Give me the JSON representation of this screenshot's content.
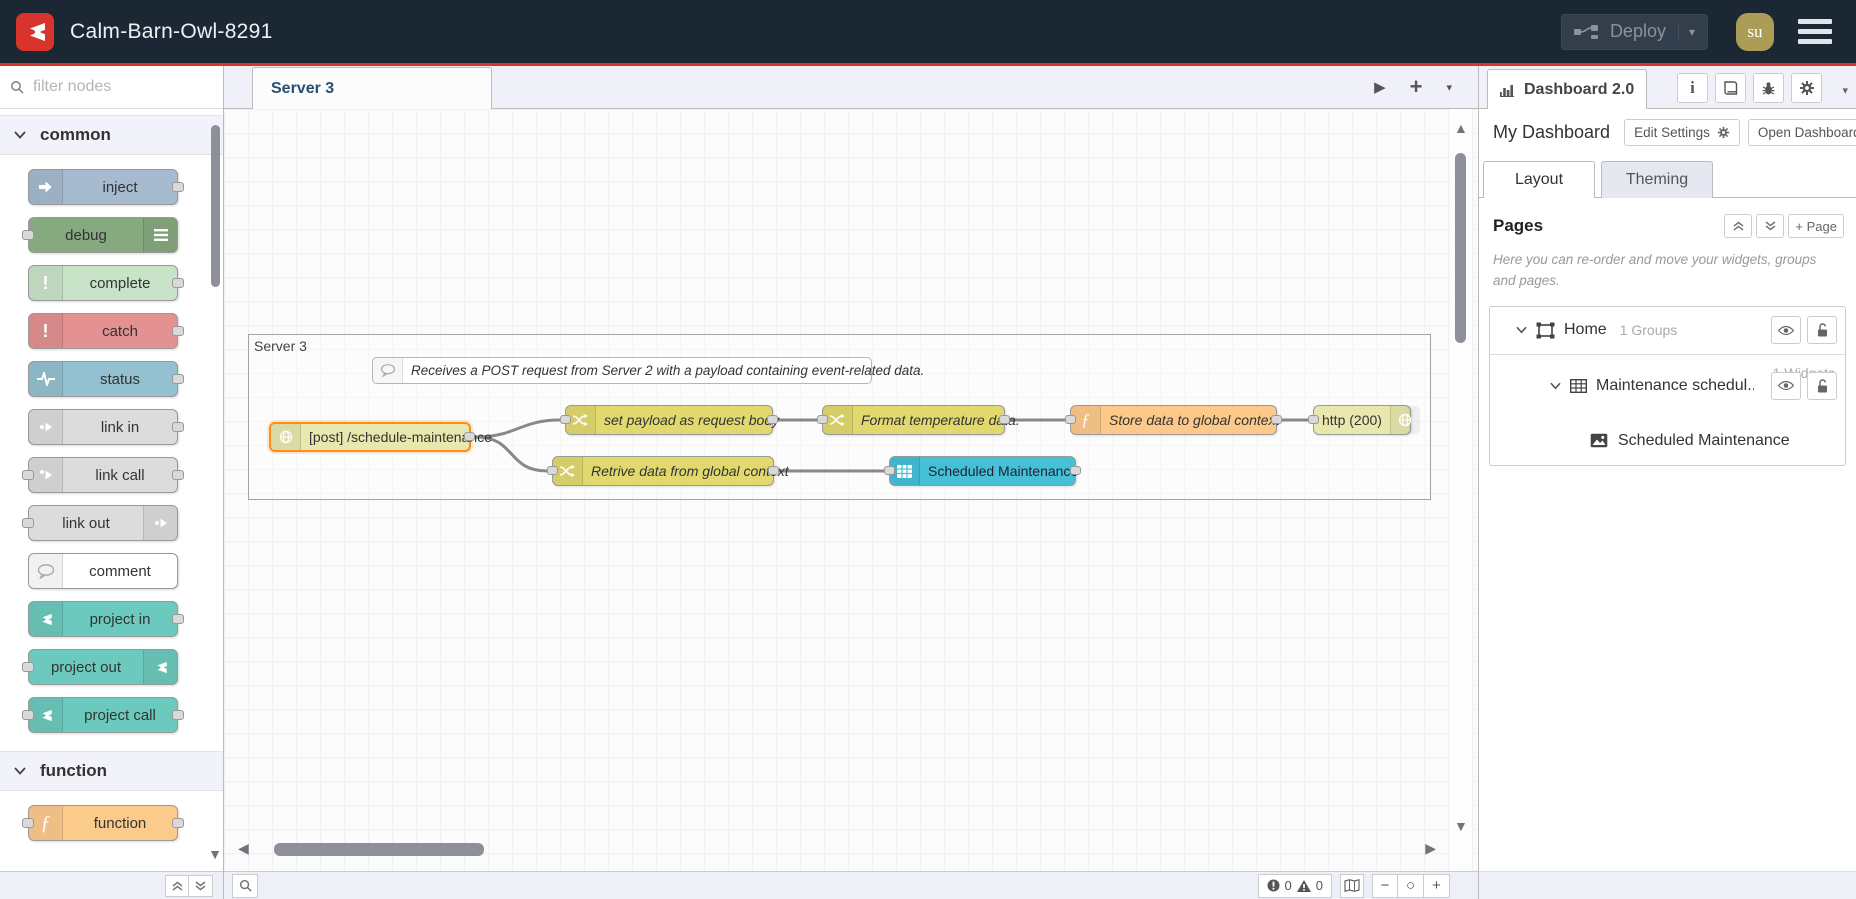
{
  "header": {
    "title": "Calm-Barn-Owl-8291",
    "deploy_label": "Deploy",
    "user_initials": "su"
  },
  "palette": {
    "search_placeholder": "filter nodes",
    "categories": [
      {
        "label": "common",
        "nodes": [
          {
            "label": "inject"
          },
          {
            "label": "debug"
          },
          {
            "label": "complete"
          },
          {
            "label": "catch"
          },
          {
            "label": "status"
          },
          {
            "label": "link in"
          },
          {
            "label": "link call"
          },
          {
            "label": "link out"
          },
          {
            "label": "comment"
          },
          {
            "label": "project in"
          },
          {
            "label": "project out"
          },
          {
            "label": "project call"
          }
        ]
      },
      {
        "label": "function",
        "nodes": [
          {
            "label": "function"
          }
        ]
      }
    ]
  },
  "workspace": {
    "tab_label": "Server 3",
    "group_label": "Server 3",
    "comment_text": "Receives a POST request from Server 2 with a payload containing event-related data.",
    "nodes": {
      "http_in": "[post] /schedule-maintenance",
      "set_payload": "set payload as request body",
      "format_temp": "Format temperature data.",
      "store_data": "Store data to global context",
      "http_response": "http (200)",
      "retrieve_data": "Retrive data from global context",
      "table_widget": "Scheduled Maintenance"
    }
  },
  "sidebar": {
    "tab_label": "Dashboard 2.0",
    "dashboard_name": "My Dashboard",
    "edit_settings_label": "Edit Settings",
    "open_dashboard_label": "Open Dashboard",
    "layout_tab": "Layout",
    "theming_tab": "Theming",
    "pages_title": "Pages",
    "add_page_label": "+ Page",
    "help_text": "Here you can re-order and move your widgets, groups and pages.",
    "tree": {
      "page_label": "Home",
      "page_meta": "1 Groups",
      "group_label": "Maintenance schedul...",
      "group_meta": "1 Widgets",
      "widget_label": "Scheduled Maintenance"
    }
  },
  "statusbar": {
    "error_count": "0",
    "warning_count": "0"
  },
  "icons": {
    "play": "▶",
    "plus": "+",
    "chevron_down": "▾",
    "minus": "−",
    "reset": "○",
    "scroll_up": "▲",
    "scroll_down": "▼",
    "scroll_left": "◀",
    "scroll_right": "▶",
    "info": "i",
    "function": "ƒ",
    "exclaim": "!"
  },
  "colors": {
    "header_bg": "#1c2734",
    "accent_red": "#d9342b",
    "avatar_gold": "#ab9d55",
    "node_inject": "#a6bbcf",
    "node_debug": "#87a980",
    "node_complete": "#c8e3c8",
    "node_catch": "#e49191",
    "node_status": "#94c1d0",
    "node_link": "#dcdcdc",
    "node_project": "#6cc9bd",
    "node_function": "#fbcb8c",
    "node_change": "#e2d96e",
    "node_http": "#e7e7ae",
    "node_table": "#45c0d6",
    "wire": "#888888"
  }
}
